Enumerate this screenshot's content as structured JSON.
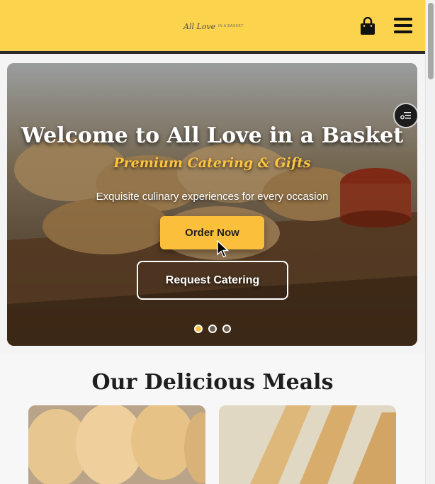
{
  "header": {
    "logo_text": "All Love",
    "logo_subtext": "IN A BASKET"
  },
  "hero": {
    "title": "Welcome to All Love in a Basket",
    "subtitle": "Premium Catering & Gifts",
    "description": "Exquisite culinary experiences for every occasion",
    "primary_button": "Order Now",
    "secondary_button": "Request Catering",
    "slides_total": 3,
    "active_slide": 1
  },
  "meals": {
    "title": "Our Delicious Meals"
  },
  "colors": {
    "header_bg": "#fcd34d",
    "accent": "#fbbf3c",
    "dark": "#1e1e1e"
  },
  "icons": {
    "cart": "shopping-bag-icon",
    "menu": "hamburger-menu-icon",
    "filter": "filter-icon"
  }
}
